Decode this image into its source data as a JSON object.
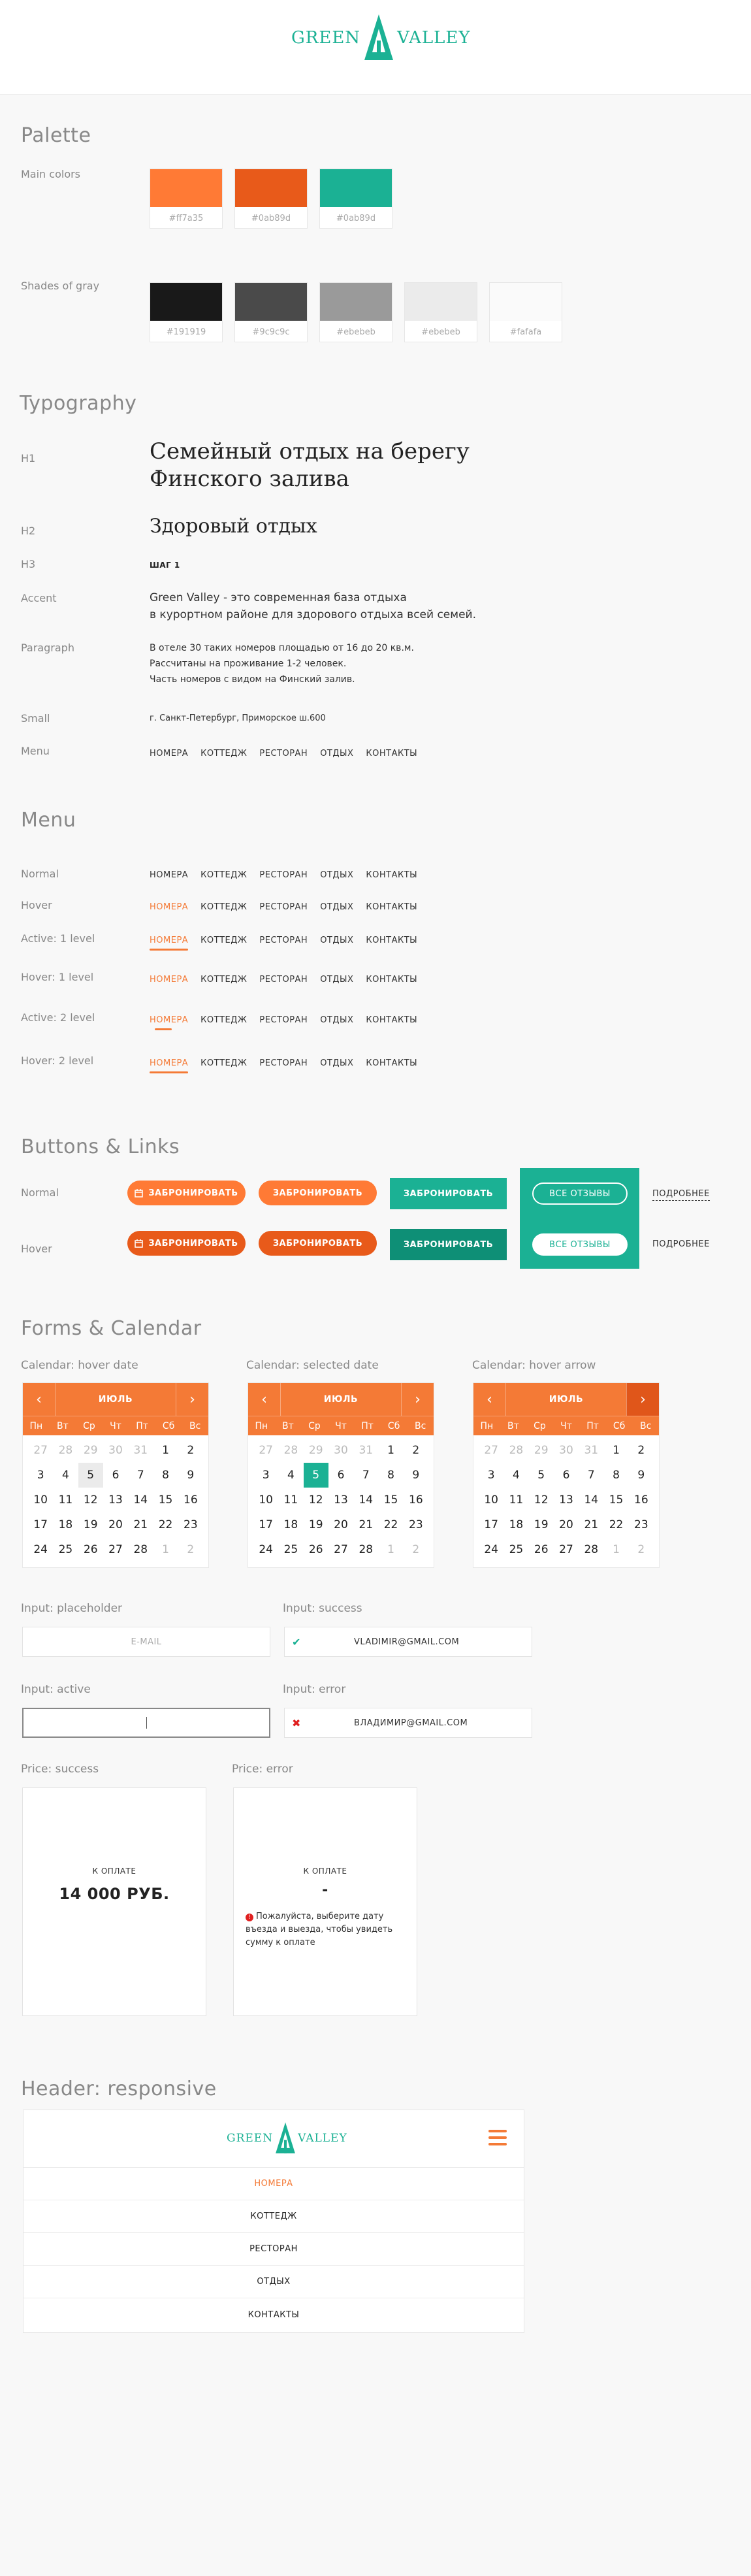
{
  "brand": {
    "left": "GREEN",
    "right": "VALLEY",
    "color": "#1bb194"
  },
  "palette": {
    "title": "Palette",
    "main_label": "Main colors",
    "gray_label": "Shades of gray",
    "main": [
      {
        "hex": "#ff7a35",
        "label": "#ff7a35"
      },
      {
        "hex": "#e85a1a",
        "label": "#0ab89d"
      },
      {
        "hex": "#1bb194",
        "label": "#0ab89d"
      }
    ],
    "grays": [
      {
        "hex": "#191919",
        "label": "#191919"
      },
      {
        "hex": "#4a4a4a",
        "label": "#9c9c9c"
      },
      {
        "hex": "#9a9a9a",
        "label": "#ebebeb"
      },
      {
        "hex": "#ebebeb",
        "label": "#ebebeb"
      },
      {
        "hex": "#fafafa",
        "label": "#fafafa"
      }
    ]
  },
  "typography": {
    "title": "Typography",
    "labels": {
      "h1": "H1",
      "h2": "H2",
      "h3": "H3",
      "accent": "Accent",
      "paragraph": "Paragraph",
      "small": "Small",
      "menu": "Menu"
    },
    "h1_line1": "Семейный отдых на  берегу",
    "h1_line2": "Финского залива",
    "h2": "Здоровый отдых",
    "h3": "ШАГ 1",
    "accent_line1": "Green Valley - это современная база отдыха",
    "accent_line2": "в курортном районе для здорового отдыха всей семей.",
    "para_line1": "В отеле 30 таких номеров площадью от 16 до 20 кв.м.",
    "para_line2": "Рассчитаны на проживание 1-2 человек.",
    "para_line3": "Часть номеров с видом на Финский залив.",
    "small": "г. Санкт-Петербург, Приморское ш.600"
  },
  "menu_items": [
    "НОМЕРА",
    "КОТТЕДЖ",
    "РЕСТОРАН",
    "ОТДЫХ",
    "КОНТАКТЫ"
  ],
  "menu_section": {
    "title": "Menu",
    "states": [
      "Normal",
      "Hover",
      "Active: 1 level",
      "Hover: 1 level",
      "Active: 2 level",
      "Hover: 2 level"
    ]
  },
  "buttons": {
    "title": "Buttons & Links",
    "normal_label": "Normal",
    "hover_label": "Hover",
    "book": "ЗАБРОНИРОВАТЬ",
    "reviews": "ВСЕ ОТЗЫВЫ",
    "more": "ПОДРОБНЕЕ",
    "orange": "#ff7a35",
    "orange_dark": "#e85a1a",
    "green": "#1bb194",
    "green_dark": "#0e8f76"
  },
  "forms": {
    "title": "Forms & Calendar",
    "cal_hover_date": "Calendar: hover date",
    "cal_selected_date": "Calendar: selected date",
    "cal_hover_arrow": "Calendar: hover arrow",
    "month": "ИЮЛЬ",
    "dows": [
      "Пн",
      "Вт",
      "Ср",
      "Чт",
      "Пт",
      "Сб",
      "Вс"
    ],
    "weeks": [
      [
        "27",
        "28",
        "29",
        "30",
        "31",
        "1",
        "2"
      ],
      [
        "3",
        "4",
        "5",
        "6",
        "7",
        "8",
        "9"
      ],
      [
        "10",
        "11",
        "12",
        "13",
        "14",
        "15",
        "16"
      ],
      [
        "17",
        "18",
        "19",
        "20",
        "21",
        "22",
        "23"
      ],
      [
        "24",
        "25",
        "26",
        "27",
        "28",
        "1",
        "2"
      ]
    ],
    "input_placeholder_label": "Input: placeholder",
    "input_success_label": "Input: success",
    "input_active_label": "Input: active",
    "input_error_label": "Input: error",
    "placeholder": "E-MAIL",
    "success_value": "VLADIMIR@GMAIL.COM",
    "error_value": "ВЛАДИМИР@GMAIL.COM",
    "price_success_label": "Price: success",
    "price_error_label": "Price: error",
    "to_pay": "К ОПЛАТЕ",
    "price_value": "14 000 РУБ.",
    "price_dash": "-",
    "error_line1": "Пожалуйста, выберите дату",
    "error_line2": "въезда и выезда, чтобы увидеть",
    "error_line3": "сумму к оплате"
  },
  "responsive": {
    "title": "Header: responsive"
  }
}
